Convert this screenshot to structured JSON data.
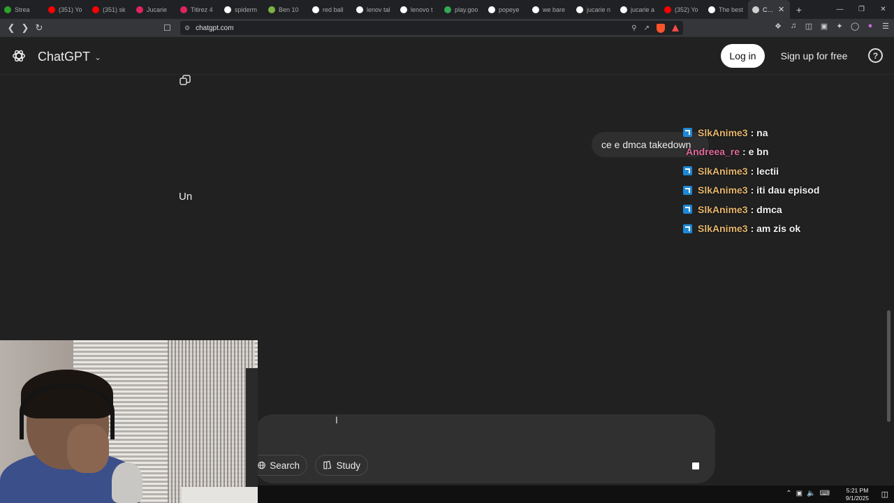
{
  "browser": {
    "tabs": [
      {
        "label": "Strea",
        "color": "#2ba32b"
      },
      {
        "label": "(351) Yo",
        "color": "#ff0000"
      },
      {
        "label": "(351) sk",
        "color": "#ff0000"
      },
      {
        "label": "Jucarie",
        "color": "#e0245e"
      },
      {
        "label": "Titirez 4",
        "color": "#e0245e"
      },
      {
        "label": "spiderm",
        "color": "#ffffff"
      },
      {
        "label": "Ben 10",
        "color": "#7cb342"
      },
      {
        "label": "red ball",
        "color": "#ffffff"
      },
      {
        "label": "lenov tal",
        "color": "#ffffff"
      },
      {
        "label": "lenovo t",
        "color": "#ffffff"
      },
      {
        "label": "play.goo",
        "color": "#34a853"
      },
      {
        "label": "popeye",
        "color": "#ffffff"
      },
      {
        "label": "we bare",
        "color": "#ffffff"
      },
      {
        "label": "jucarie n",
        "color": "#ffffff"
      },
      {
        "label": "jucarie a",
        "color": "#ffffff"
      },
      {
        "label": "(352) Yo",
        "color": "#ff0000"
      },
      {
        "label": "The best",
        "color": "#ffffff"
      },
      {
        "label": "Cha",
        "color": "#cfcfcf"
      }
    ],
    "url": "chatgpt.com"
  },
  "header": {
    "brand": "ChatGPT",
    "login_label": "Log in",
    "signup_label": "Sign up for free",
    "help_glyph": "?"
  },
  "conversation": {
    "user_message": "ce e dmca takedown",
    "assistant_partial": "Un"
  },
  "chat_overlay": [
    {
      "nick": "SlkAnime3",
      "message": " : na",
      "badge": true,
      "nick_color": "gold"
    },
    {
      "nick": "Andreea_re",
      "message": " : e bn",
      "badge": false,
      "nick_color": "pink"
    },
    {
      "nick": "SlkAnime3",
      "message": " : lectii",
      "badge": true,
      "nick_color": "gold"
    },
    {
      "nick": "SlkAnime3",
      "message": " : iti dau episod",
      "badge": true,
      "nick_color": "gold"
    },
    {
      "nick": "SlkAnime3",
      "message": " : dmca",
      "badge": true,
      "nick_color": "gold"
    },
    {
      "nick": "SlkAnime3",
      "message": " : am zis ok",
      "badge": true,
      "nick_color": "gold"
    }
  ],
  "composer": {
    "search_label": "Search",
    "study_label": "Study"
  },
  "taskbar": {
    "time": "5:21 PM",
    "date": "9/1/2025"
  }
}
